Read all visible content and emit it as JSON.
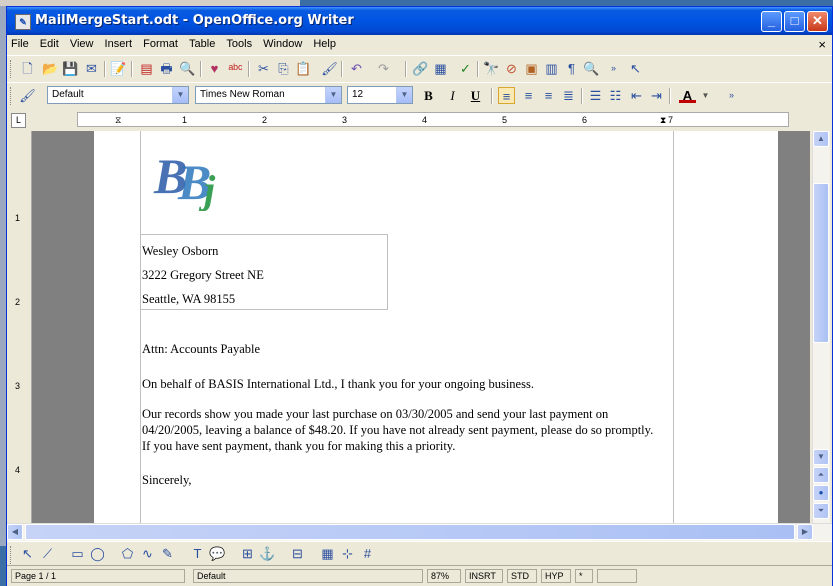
{
  "window": {
    "title": "MailMergeStart.odt - OpenOffice.org Writer"
  },
  "menu": [
    "File",
    "Edit",
    "View",
    "Insert",
    "Format",
    "Table",
    "Tools",
    "Window",
    "Help"
  ],
  "formatting": {
    "style": "Default",
    "font": "Times New Roman",
    "size": "12"
  },
  "ruler_labels": [
    "1",
    "2",
    "3",
    "4",
    "5",
    "6",
    "7"
  ],
  "vruler_labels": [
    "1",
    "2",
    "3",
    "4"
  ],
  "document": {
    "logo_text": "BBj",
    "address": [
      "Wesley Osborn",
      "3222 Gregory Street NE",
      "Seattle, WA 98155"
    ],
    "attn": "Attn: Accounts Payable",
    "para1": "On behalf of BASIS International Ltd., I thank you for your ongoing business.",
    "para2": "Our records show you made your last purchase on 03/30/2005 and send your last payment on\n04/20/2005, leaving a balance of $48.20. If you have not already sent payment, please do so promptly.\nIf you have sent payment, thank you for making this a priority.",
    "closing": "Sincerely,"
  },
  "status": {
    "page": "Page 1 / 1",
    "style": "Default",
    "zoom": "87%",
    "insert": "INSRT",
    "selection": "STD",
    "hyperlink": "HYP",
    "modified": "*"
  }
}
